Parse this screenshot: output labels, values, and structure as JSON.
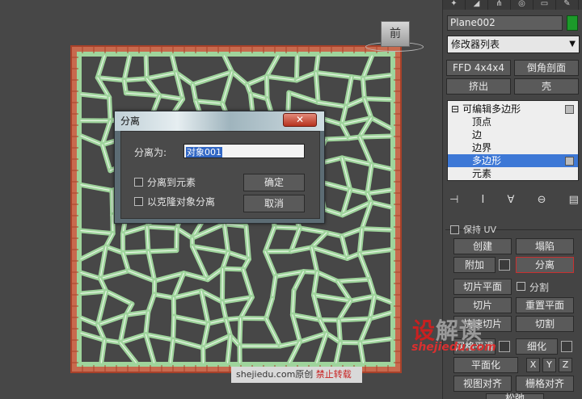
{
  "viewport": {
    "viewcube_label": "前",
    "watermark_site": "shejiedu.com原创",
    "watermark_warning": "禁止转载"
  },
  "dialog": {
    "title": "分离",
    "close_glyph": "✕",
    "name_label": "分离为:",
    "name_value": "对象001",
    "detach_to_element": "分离到元素",
    "detach_as_clone": "以克隆对象分离",
    "ok_label": "确定",
    "cancel_label": "取消"
  },
  "panel": {
    "object_name": "Plane002",
    "object_color": "#1c9a2a",
    "modifier_list": "修改器列表",
    "ffd_label": "FFD 4x4x4",
    "bevel_profile_label": "倒角剖面",
    "extrude_label": "挤出",
    "shell_label": "壳",
    "stack": [
      {
        "label": "可编辑多边形",
        "prefix": "⊟",
        "indent": 4,
        "selected": false
      },
      {
        "label": "顶点",
        "prefix": "",
        "indent": 30,
        "selected": false
      },
      {
        "label": "边",
        "prefix": "",
        "indent": 30,
        "selected": false
      },
      {
        "label": "边界",
        "prefix": "",
        "indent": 30,
        "selected": false
      },
      {
        "label": "多边形",
        "prefix": "",
        "indent": 30,
        "selected": true
      },
      {
        "label": "元素",
        "prefix": "",
        "indent": 30,
        "selected": false
      }
    ],
    "edit_geometry": {
      "preserve_uv_partial": "保持 UV",
      "create_label": "创建",
      "collapse_label": "塌陷",
      "attach_label": "附加",
      "detach_label": "分离",
      "slice_plane_label": "切片平面",
      "split_label": "分割",
      "slice_label": "切片",
      "reset_plane_label": "重置平面",
      "quickslice_label": "快速切片",
      "cut_label": "切割",
      "meshsmooth_label": "网格平滑",
      "tessellate_label": "细化",
      "planarize_label": "平面化",
      "x_label": "X",
      "y_label": "Y",
      "z_label": "Z",
      "view_align_label": "视图对齐",
      "grid_align_label": "栅格对齐",
      "relax_partial": "松弛"
    },
    "site_logo_red": "设",
    "site_logo_gray": "解读",
    "site_url": "shejiedu.com"
  }
}
